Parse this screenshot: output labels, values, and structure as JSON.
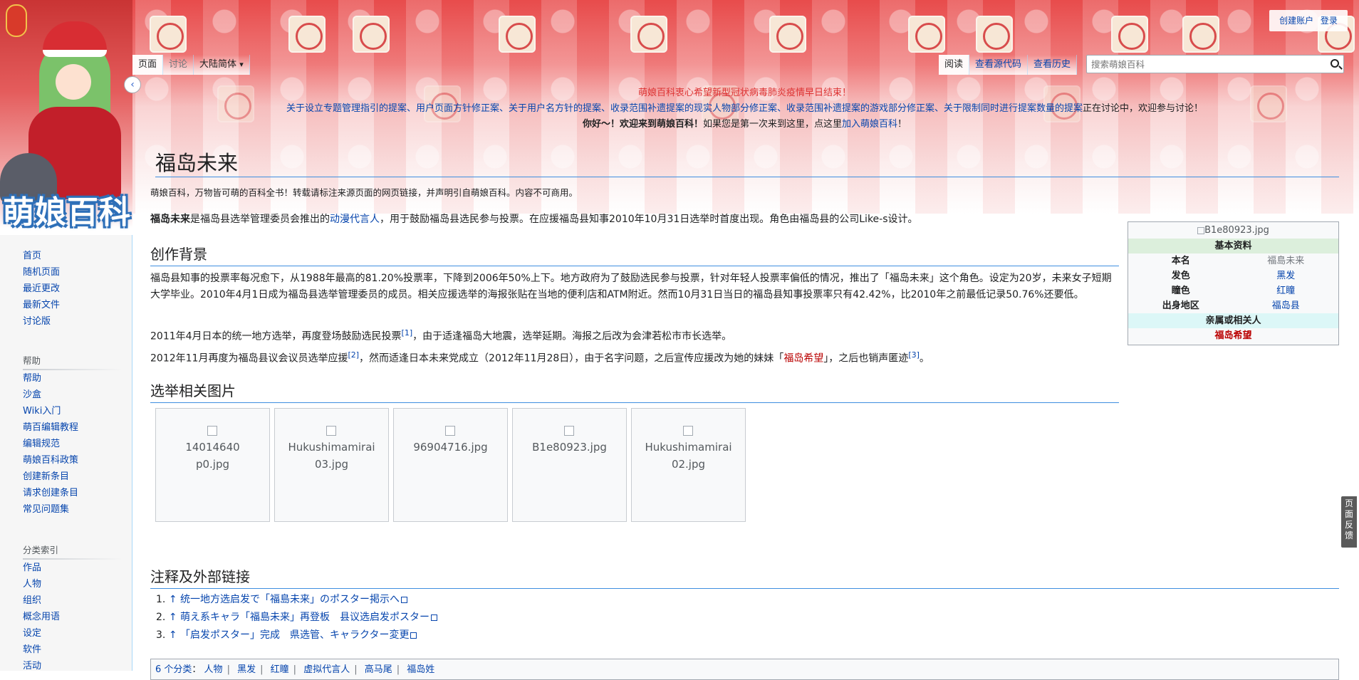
{
  "site": {
    "logo_text": "萌娘百科"
  },
  "personal": {
    "create_account": "创建账户",
    "login": "登录"
  },
  "tabs_left": [
    {
      "label": "页面",
      "state": "selected"
    },
    {
      "label": "讨论",
      "state": "muted"
    },
    {
      "label": "大陆简体",
      "state": "dropdown"
    }
  ],
  "tabs_right": [
    {
      "label": "阅读",
      "state": "selected"
    },
    {
      "label": "查看源代码",
      "state": "link"
    },
    {
      "label": "查看历史",
      "state": "link"
    }
  ],
  "search": {
    "placeholder": "搜索萌娘百科"
  },
  "sidebar": {
    "nav": [
      "首页",
      "随机页面",
      "最近更改",
      "最新文件",
      "讨论版"
    ],
    "help_heading": "帮助",
    "help": [
      "帮助",
      "沙盒",
      "Wiki入门",
      "萌百编辑教程",
      "编辑规范",
      "萌娘百科政策",
      "创建新条目",
      "请求创建条目",
      "常见问题集"
    ],
    "category_heading": "分类索引",
    "categories": [
      "作品",
      "人物",
      "组织",
      "概念用语",
      "设定",
      "软件",
      "活动"
    ]
  },
  "sitenotice": {
    "line1": "萌娘百科衷心希望新型冠状病毒肺炎疫情早日结束！",
    "line2_links": "关于设立专题管理指引的提案、用户页面方针修正案、关于用户名方针的提案、收录范围补遗提案的现实人物部分修正案、收录范围补遗提案的游戏部分修正案、关于限制同时进行提案数量的提案",
    "line2_tail": "正在讨论中，欢迎参与讨论！",
    "line3_bold": "你好～！欢迎来到萌娘百科！",
    "line3_text": "如果您是第一次来到这里，点这里",
    "line3_link": "加入萌娘百科",
    "line3_end": "！"
  },
  "page": {
    "title": "福岛未来",
    "tagline": "萌娘百科，万物皆可萌的百科全书！转载请标注来源页面的网页链接，并声明引自萌娘百科。内容不可商用。",
    "intro_bold": "福岛未来",
    "intro_1": "是福岛县选举管理委员会推出的",
    "intro_link": "动漫代言人",
    "intro_2": "，用于鼓励福岛县选民参与投票。在应援福岛县知事2010年10月31日选举时首度出现。角色由福岛县的公司Like-s设计。"
  },
  "sections": {
    "background_title": "创作背景",
    "background_p1": "福岛县知事的投票率每况愈下，从1988年最高的81.20%投票率，下降到2006年50%上下。地方政府为了鼓励选民参与投票，针对年轻人投票率偏低的情况，推出了「福岛未来」这个角色。设定为20岁，未来女子短期大学毕业。2010年4月1日成为福岛县选举管理委员的成员。相关应援选举的海报张贴在当地的便利店和ATM附近。然而10月31日当日的福岛县知事投票率只有42.42%，比2010年之前最低记录50.76%还要低。",
    "background_p2a": "2011年4月日本的统一地方选举，再度登场鼓励选民投票",
    "background_p2_ref": "[1]",
    "background_p2b": "，由于适逢福岛大地震，选举延期。海报之后改为会津若松市市长选举。",
    "background_p3a": "2012年11月再度为福岛县议会议员选举应援",
    "background_p3_ref1": "[2]",
    "background_p3b": "，然而适逢日本未来党成立（2012年11月28日），由于名字问题，之后宣传应援改为她的妹妹「",
    "background_p3_link": "福岛希望",
    "background_p3c": "」，之后也销声匿迹",
    "background_p3_ref2": "[3]",
    "background_p3d": "。",
    "gallery_title": "选举相关图片",
    "references_title": "注释及外部链接"
  },
  "infobox": {
    "image_alt": "B1e80923.jpg",
    "header_basic": "基本资料",
    "rows": [
      {
        "key": "本名",
        "value": "福島未来"
      },
      {
        "key": "发色",
        "value": "黑发"
      },
      {
        "key": "瞳色",
        "value": "红瞳"
      },
      {
        "key": "出身地区",
        "value": "福岛县"
      }
    ],
    "header_relatives": "亲属或相关人",
    "relative": "福岛希望"
  },
  "gallery": [
    {
      "line1": "14014640",
      "line2": "p0.jpg"
    },
    {
      "line1": "Hukushimamirai",
      "line2": "03.jpg"
    },
    {
      "line1": "96904716.jpg",
      "line2": ""
    },
    {
      "line1": "B1e80923.jpg",
      "line2": ""
    },
    {
      "line1": "Hukushimamirai",
      "line2": "02.jpg"
    }
  ],
  "references": [
    {
      "num": "1.",
      "arrow": "↑",
      "text": "统一地方选启发で「福島未来」のポスター掲示へ"
    },
    {
      "num": "2.",
      "arrow": "↑",
      "text": "萌え系キャラ「福島未来」再登板　县议选启发ポスター"
    },
    {
      "num": "3.",
      "arrow": "↑",
      "text": "「启发ポスター」完成　県选管、キャラクター変更"
    }
  ],
  "catlinks": {
    "label": "6 个分类",
    "items": [
      "人物",
      "黑发",
      "红瞳",
      "虚拟代言人",
      "高马尾",
      "福岛姓"
    ]
  },
  "feedback": {
    "label": "页面反馈"
  }
}
